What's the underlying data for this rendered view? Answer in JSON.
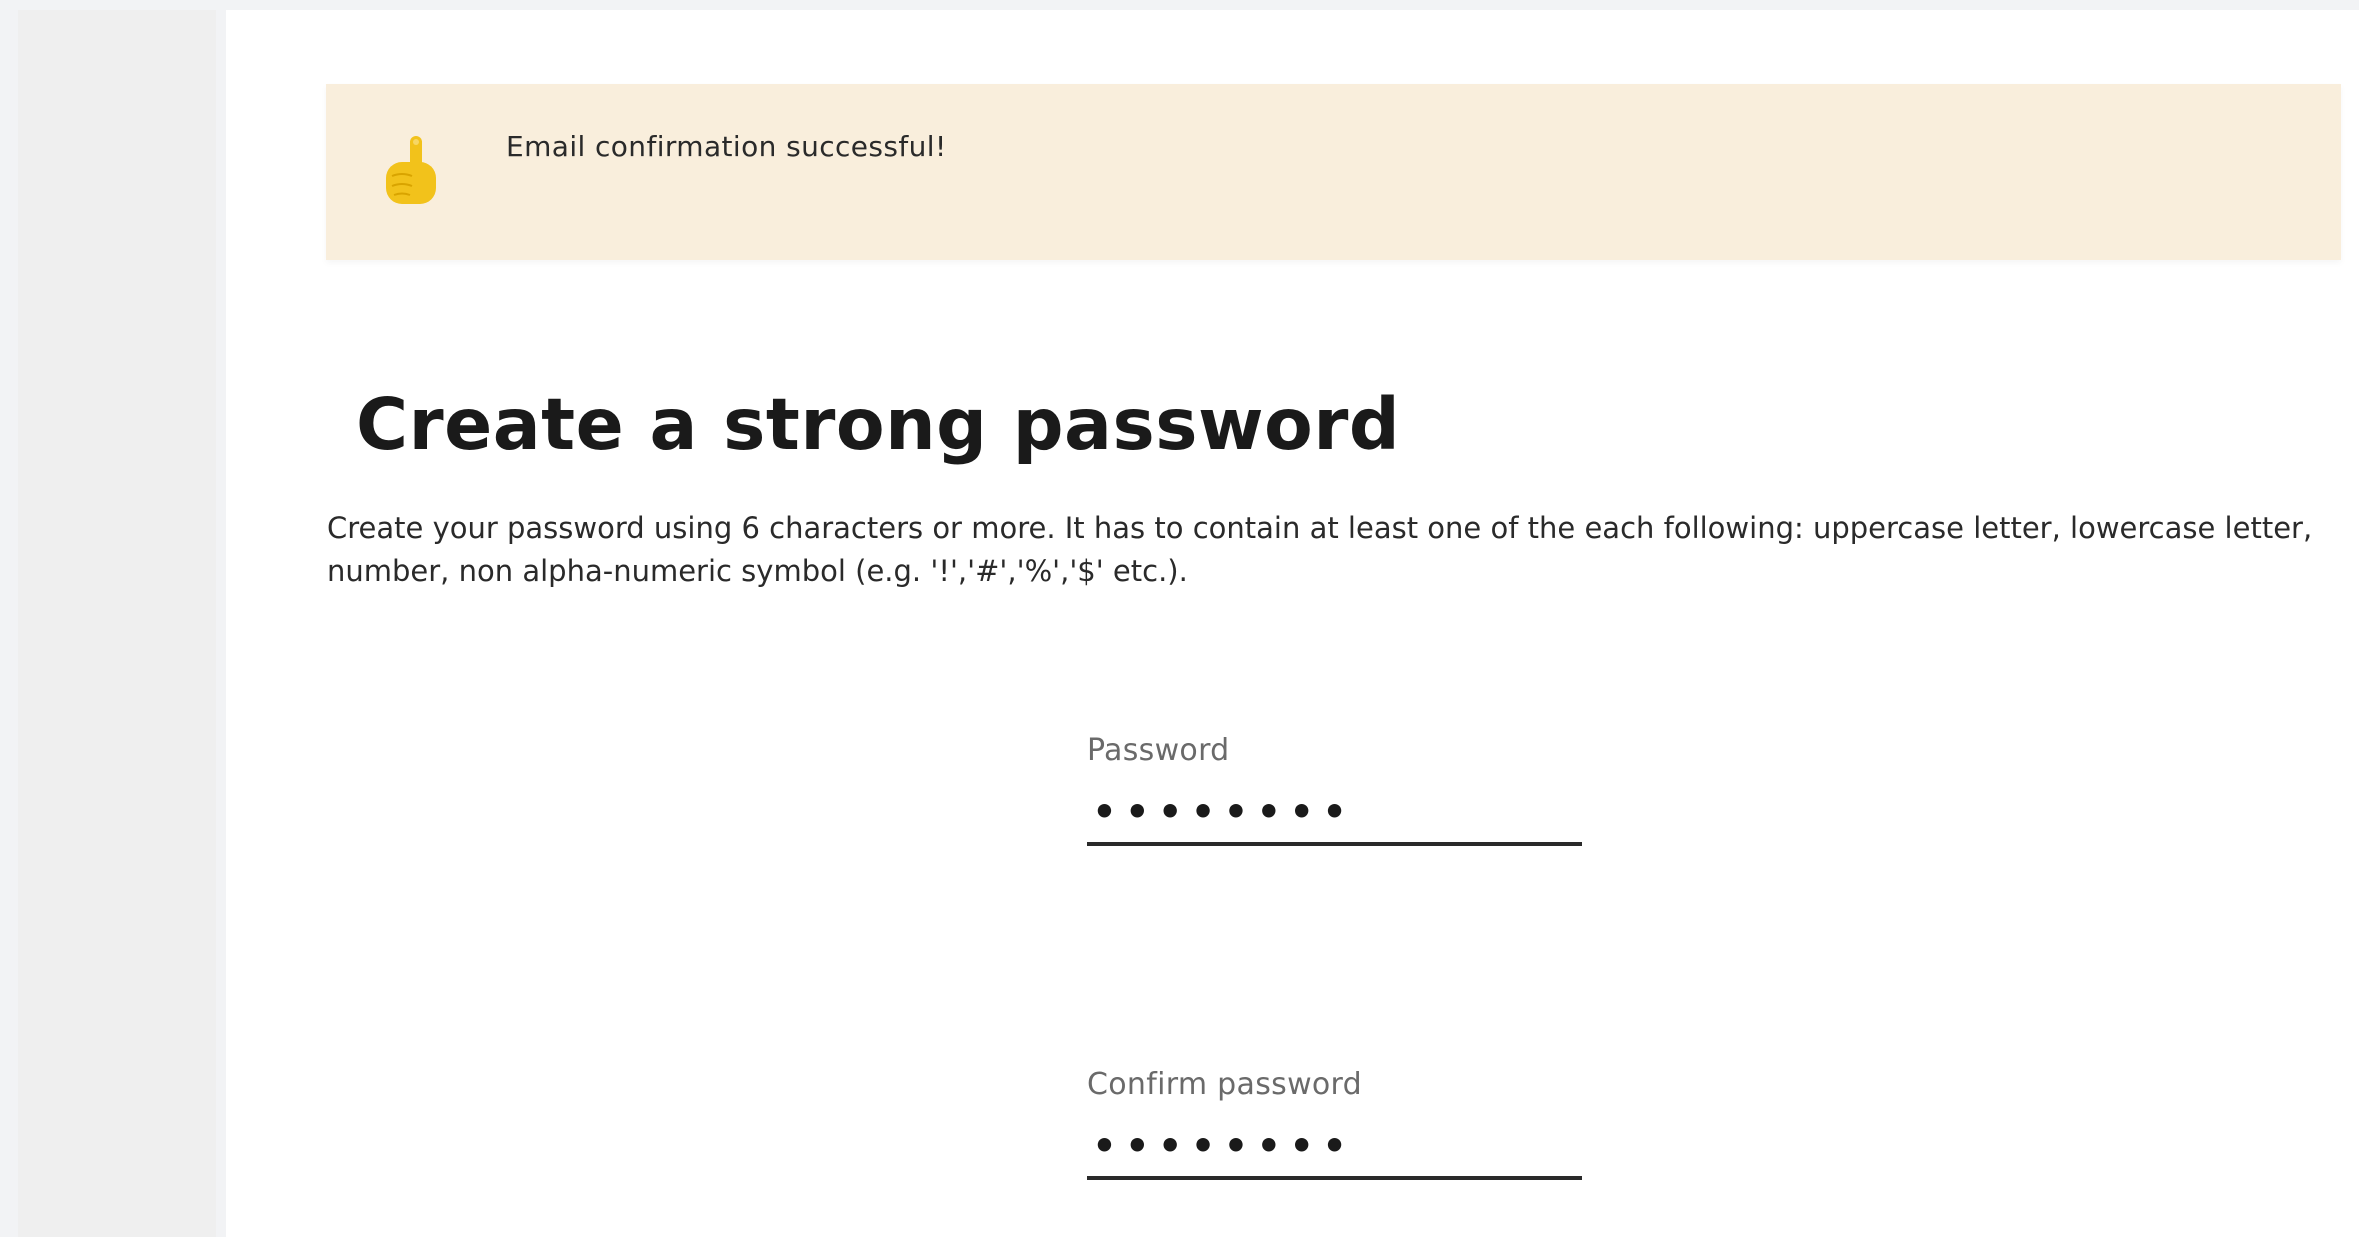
{
  "banner": {
    "icon": "pointing-up-hand-icon",
    "message": "Email confirmation successful!",
    "background": "#f9eedc"
  },
  "heading": "Create a strong password",
  "description": "Create your password using 6 characters or more. It has to contain at least one of the each following: uppercase letter, lowercase letter, number, non alpha-numeric symbol (e.g. '!','#','%','$' etc.).",
  "password_field": {
    "label": "Password",
    "value": "••••••••"
  },
  "confirm_password_field": {
    "label": "Confirm password",
    "value": "••••••••"
  }
}
